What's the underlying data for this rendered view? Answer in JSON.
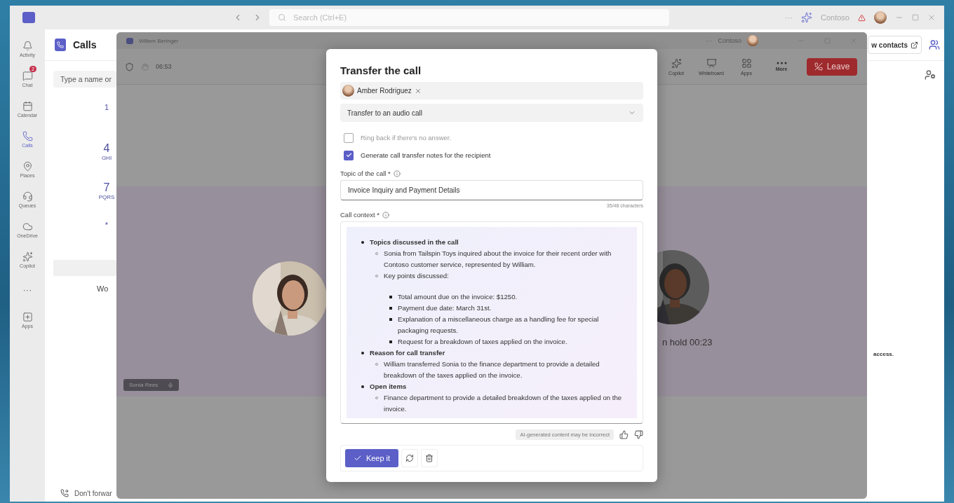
{
  "app": {
    "search_placeholder": "Search (Ctrl+E)",
    "more": "···",
    "org": "Contoso"
  },
  "rail": [
    {
      "label": "Activity",
      "selected": false
    },
    {
      "label": "Chat",
      "selected": false,
      "badge": "2"
    },
    {
      "label": "Calendar",
      "selected": false
    },
    {
      "label": "Calls",
      "selected": true
    },
    {
      "label": "Places",
      "selected": false
    },
    {
      "label": "Queues",
      "selected": false
    },
    {
      "label": "OneDrive",
      "selected": false
    },
    {
      "label": "Copilot",
      "selected": false
    },
    {
      "label": "···",
      "selected": false
    },
    {
      "label": "Apps",
      "selected": false
    }
  ],
  "calls": {
    "title": "Calls",
    "search_placeholder": "Type a name or",
    "keys": [
      {
        "digit": "1"
      },
      {
        "digit": "4",
        "letters": "GHI"
      },
      {
        "digit": "7",
        "letters": "PQRS"
      },
      {
        "digit": "*"
      }
    ],
    "cut_text": "Wo",
    "forward": "Don't forwar",
    "contacts_button": "w contacts",
    "notice": "access."
  },
  "call_window": {
    "title": "Willem Beringer",
    "more": "···",
    "org": "Contoso",
    "timer": "06:53",
    "tools": [
      {
        "label": "Copilot"
      },
      {
        "label": "Whiteboard"
      },
      {
        "label": "Apps"
      },
      {
        "label": "More"
      }
    ],
    "leave": "Leave",
    "name_tag": "Sonia Rees",
    "hold_status": "n hold 00:23"
  },
  "dialog": {
    "title": "Transfer the call",
    "recipient": "Amber Rodriguez",
    "mode": "Transfer to an audio call",
    "options": [
      {
        "label": "Ring back if there's no answer.",
        "checked": false
      },
      {
        "label": "Generate call transfer notes for the recipient",
        "checked": true
      }
    ],
    "topic": {
      "label": "Topic of the call *",
      "value": "Invoice Inquiry and Payment Details",
      "counter": "35/48 characters"
    },
    "context": {
      "label": "Call context *",
      "outline": [
        {
          "text": "Topics discussed in the call",
          "children": [
            {
              "text": "Sonia from Tailspin Toys inquired about the invoice for their recent order with Contoso customer service, represented by William."
            },
            {
              "text": "Key points discussed:",
              "children": [
                {
                  "text": "Total amount due on the invoice: $1250."
                },
                {
                  "text": "Payment due date: March 31st."
                },
                {
                  "text": "Explanation of a miscellaneous charge as a handling fee for special packaging requests."
                },
                {
                  "text": "Request for a breakdown of taxes applied on the invoice."
                }
              ]
            }
          ]
        },
        {
          "text": "Reason for call transfer",
          "children": [
            {
              "text": "William transferred Sonia to the finance department to provide a detailed breakdown of the taxes applied on the invoice."
            }
          ]
        },
        {
          "text": "Open items",
          "children": [
            {
              "text": "Finance department to provide a detailed breakdown of the taxes applied on the invoice."
            }
          ]
        }
      ]
    },
    "disclaimer": "AI-generated content may be incorrect",
    "keep": "Keep it"
  }
}
